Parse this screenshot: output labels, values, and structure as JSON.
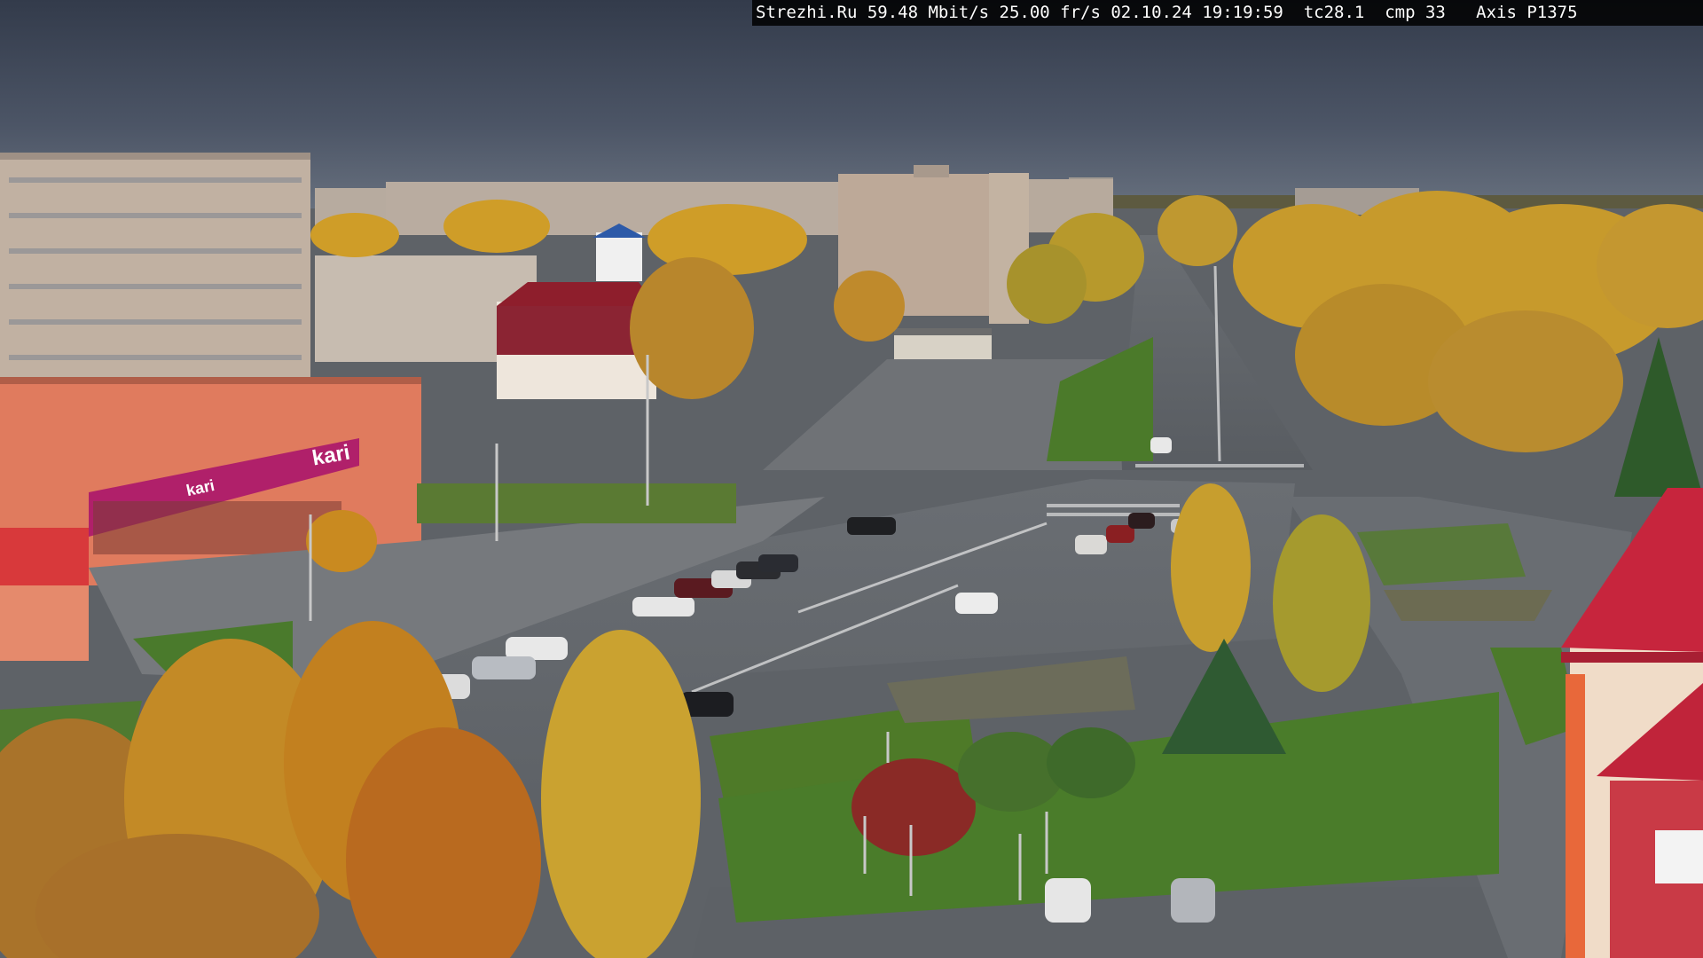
{
  "overlay": {
    "text": "Strezhi.Ru 59.48 Mbit/s 25.00 fr/s 02.10.24 19:19:59  tc28.1  cmp 33   Axis P1375"
  },
  "signs": {
    "store_logo": "kari",
    "store_logo_small": "kari"
  },
  "colors": {
    "sky": "#3e4757",
    "asphalt": "#5f646a",
    "grass": "#4f7d2c",
    "autumn_foliage": "#d4a02a",
    "store_magenta": "#b0206a"
  }
}
